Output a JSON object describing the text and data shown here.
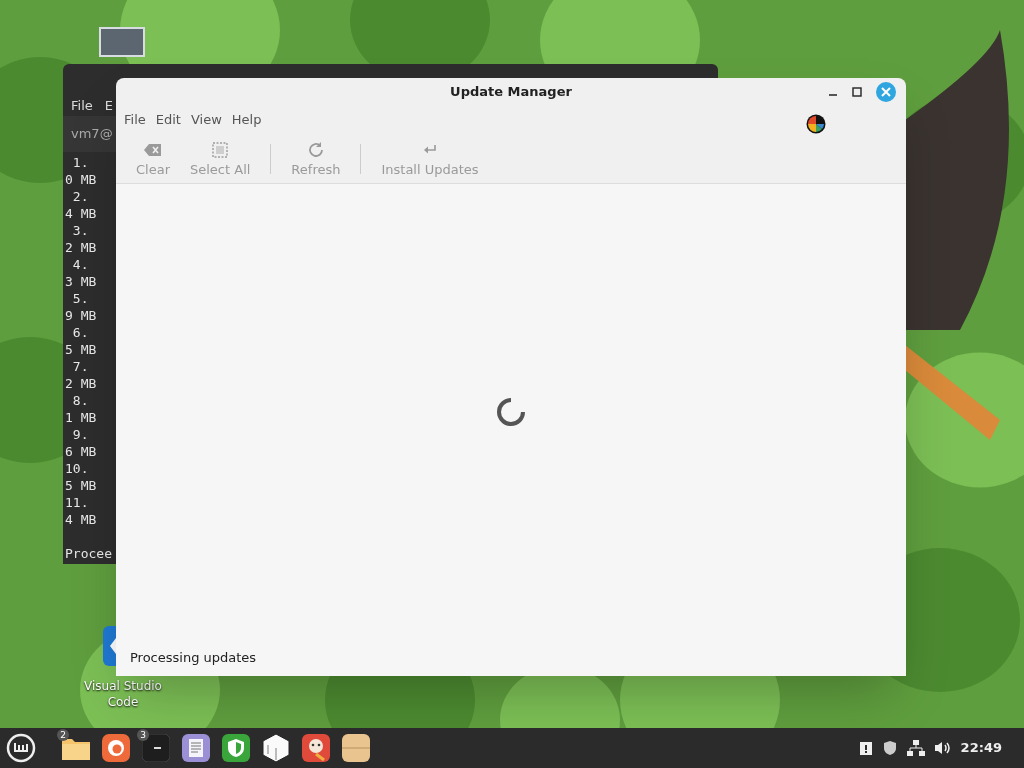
{
  "terminal": {
    "menu": [
      "File",
      "E"
    ],
    "prompt": "vm7@",
    "lines": [
      " 1.",
      "0 MB",
      " 2.",
      "4 MB",
      " 3.",
      "2 MB",
      " 4.",
      "3 MB",
      " 5.",
      "9 MB",
      " 6.",
      "5 MB",
      " 7.",
      "2 MB",
      " 8.",
      "1 MB",
      " 9.",
      "6 MB",
      "10.",
      "5 MB",
      "11.",
      "4 MB"
    ],
    "footer": "Procee"
  },
  "desktop_icons": [
    {
      "label": "Visual Studio Code"
    }
  ],
  "window": {
    "title": "Update Manager",
    "menu": [
      "File",
      "Edit",
      "View",
      "Help"
    ],
    "toolbar": [
      {
        "kind": "clear",
        "label": "Clear",
        "disabled": true
      },
      {
        "kind": "select-all",
        "label": "Select All",
        "disabled": true
      },
      {
        "kind": "separator"
      },
      {
        "kind": "refresh",
        "label": "Refresh",
        "disabled": true
      },
      {
        "kind": "separator"
      },
      {
        "kind": "install",
        "label": "Install Updates",
        "disabled": true
      }
    ],
    "status": "Processing updates"
  },
  "taskbar": {
    "apps": [
      {
        "kind": "files",
        "badge": "2"
      },
      {
        "kind": "browser"
      },
      {
        "kind": "terminal",
        "badge": "3"
      },
      {
        "kind": "notes"
      },
      {
        "kind": "shield"
      },
      {
        "kind": "cube"
      },
      {
        "kind": "paint"
      },
      {
        "kind": "archive"
      }
    ],
    "clock": "22:49"
  }
}
